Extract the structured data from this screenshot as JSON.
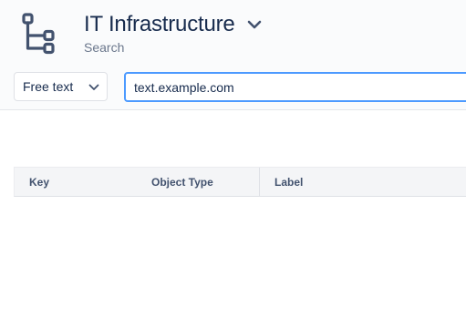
{
  "header": {
    "title": "IT Infrastructure",
    "subtitle": "Search",
    "icon": "hierarchy-tree-icon",
    "dropdown_icon": "chevron-down-icon"
  },
  "search": {
    "mode_selected": "Free text",
    "query_value": "text.example.com"
  },
  "table": {
    "columns": [
      "Key",
      "Object Type",
      "Label"
    ]
  },
  "colors": {
    "accent": "#4c9aff",
    "icon": "#42526e",
    "header_bg": "#fafbfc",
    "table_header_bg": "#f4f5f7"
  }
}
